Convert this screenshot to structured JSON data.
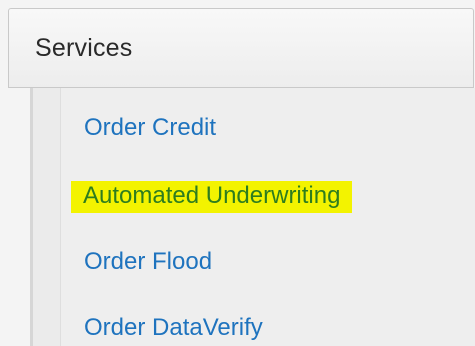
{
  "panel": {
    "title": "Services"
  },
  "nav": {
    "items": [
      {
        "label": "Order Credit",
        "highlighted": false
      },
      {
        "label": "Automated Underwriting",
        "highlighted": true
      },
      {
        "label": "Order Flood",
        "highlighted": false
      },
      {
        "label": "Order DataVerify",
        "highlighted": false
      }
    ]
  },
  "colors": {
    "link": "#1e73be",
    "highlight_background": "#f3f300",
    "highlight_text": "#2e7d1e"
  }
}
